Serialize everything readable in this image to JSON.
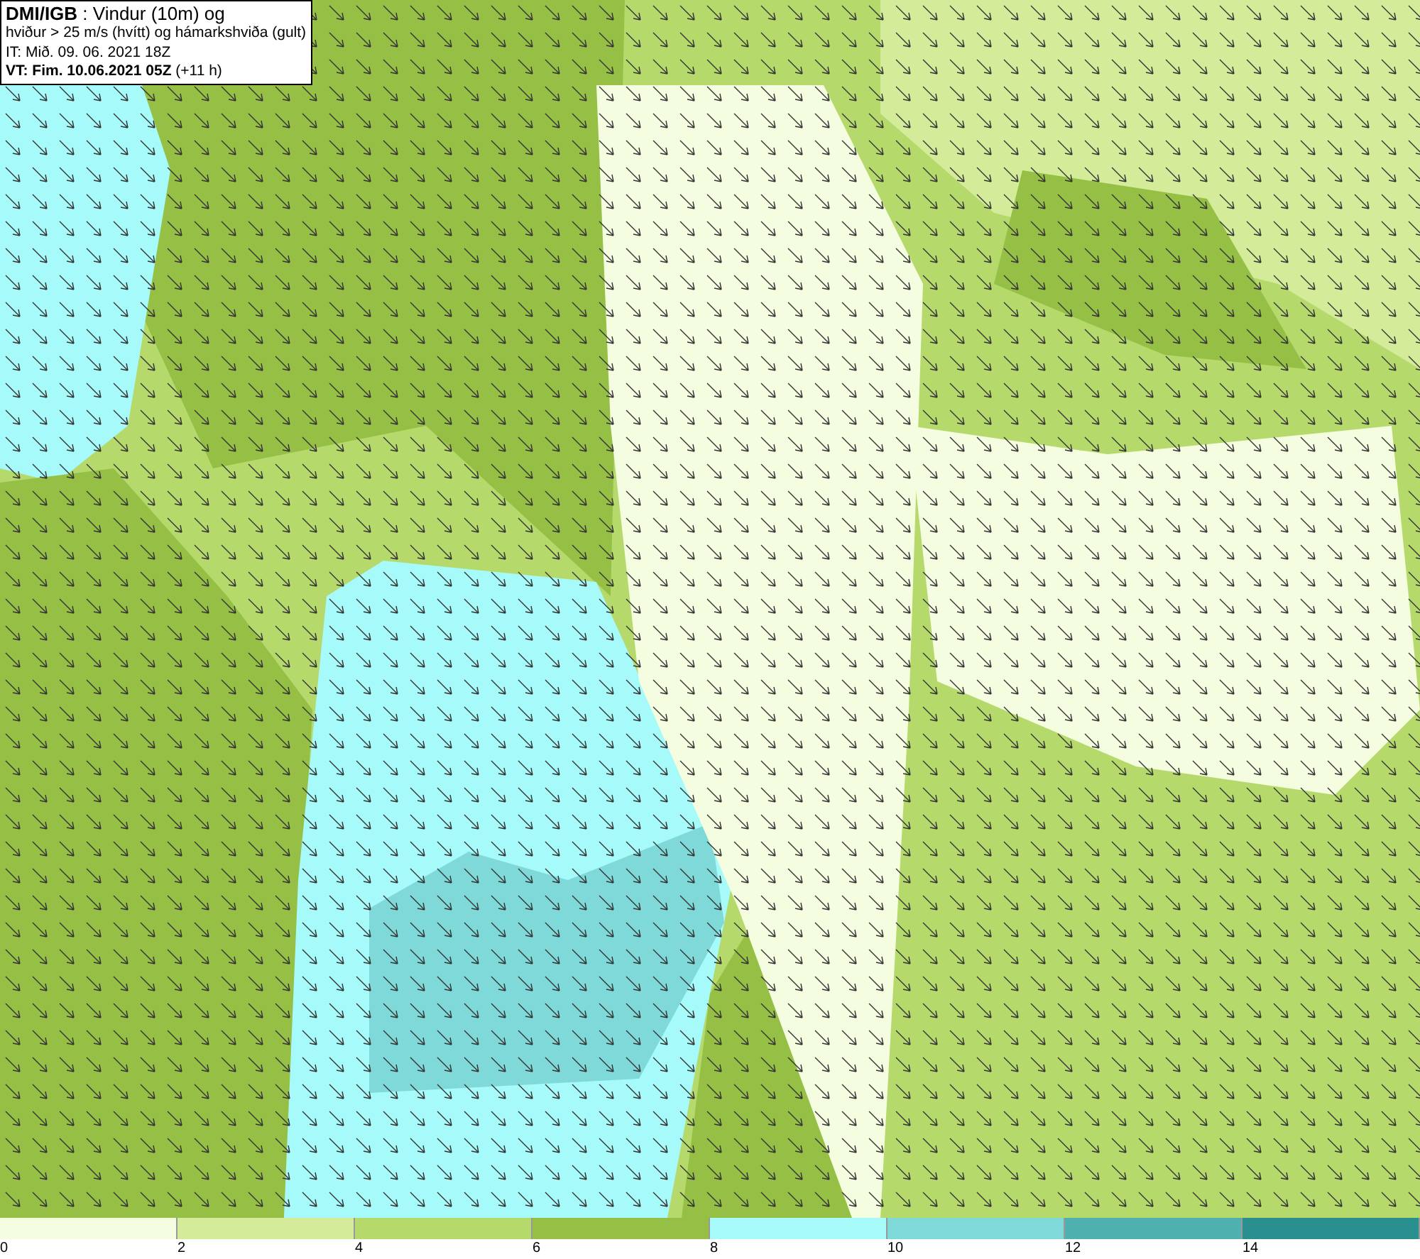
{
  "map": {
    "info_box": [
      "**DMI/IGB** : Vindur (10m) og",
      "hviður > 25 m/s (hvítt) og hámarkshviða (gult)",
      "IT: Mið. 09. 06. 2021 18Z",
      "**VT: Fim. 10.06.2021 05Z** (+11 h)"
    ]
  },
  "legend": [
    {
      "label": "0",
      "color": "#f5fde0"
    },
    {
      "label": "2",
      "color": "#d4ec9a"
    },
    {
      "label": "4",
      "color": "#b6d96c"
    },
    {
      "label": "6",
      "color": "#95bf45"
    },
    {
      "label": "8",
      "color": "#a7fafa"
    },
    {
      "label": "10",
      "color": "#80d9d9"
    },
    {
      "label": "12",
      "color": "#4fb0b0"
    },
    {
      "label": "14",
      "color": "#2a8f8f"
    }
  ]
}
